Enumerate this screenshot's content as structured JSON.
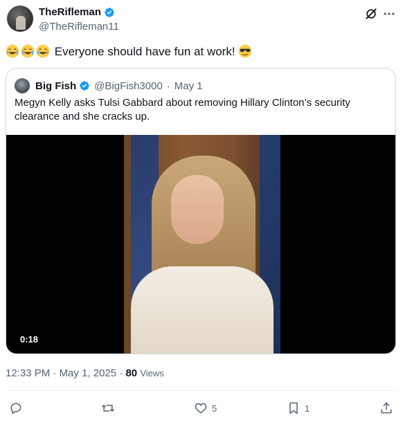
{
  "tweet": {
    "author": {
      "display_name": "TheRifleman",
      "handle": "@TheRifleman11",
      "verified": true
    },
    "text": "Everyone should have fun at work!",
    "leading_emojis": [
      "joy-emoji",
      "joy-emoji",
      "joy-emoji"
    ],
    "trailing_emoji": "sunglasses-emoji",
    "time": "12:33 PM",
    "date": "May 1, 2025",
    "separator": "·",
    "views_count": "80",
    "views_label": "Views"
  },
  "quote": {
    "author": {
      "display_name": "Big Fish",
      "handle": "@BigFish3000",
      "date": "May 1",
      "verified": true
    },
    "text": "Megyn Kelly asks Tulsi Gabbard about removing Hillary Clinton’s security clearance and she cracks up.",
    "video": {
      "duration": "0:18"
    }
  },
  "actions": {
    "reply": {
      "icon": "reply-icon",
      "count": ""
    },
    "repost": {
      "icon": "repost-icon",
      "count": ""
    },
    "like": {
      "icon": "heart-icon",
      "count": "5"
    },
    "bookmark": {
      "icon": "bookmark-icon",
      "count": "1"
    },
    "share": {
      "icon": "share-icon",
      "count": ""
    }
  },
  "colors": {
    "accent": "#1d9bf0",
    "text_primary": "#0f1419",
    "text_secondary": "#536471",
    "border": "#cfd9de"
  }
}
